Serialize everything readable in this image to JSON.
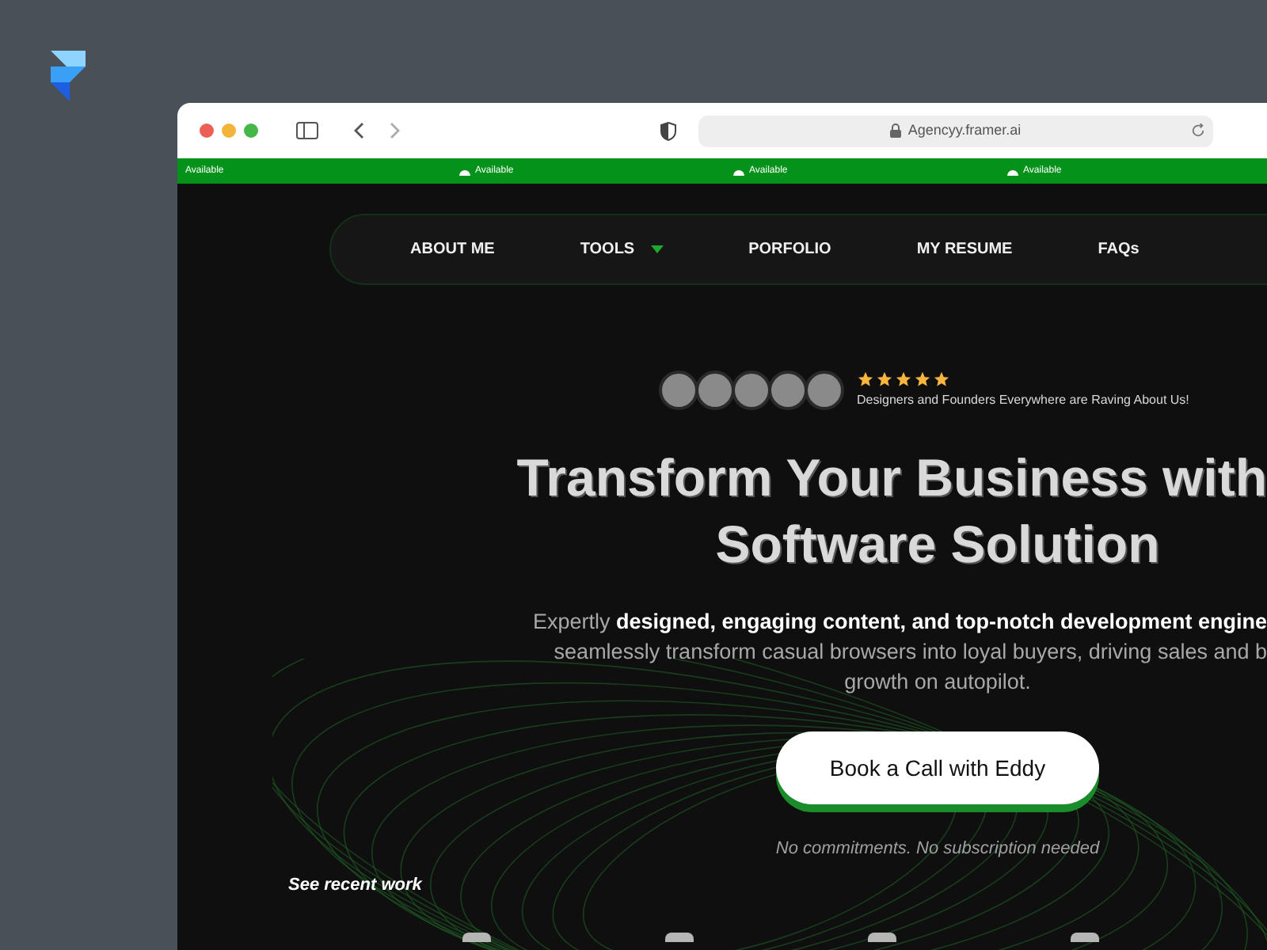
{
  "browser": {
    "url": "Agencyy.framer.ai"
  },
  "ticker": [
    {
      "label": "Available",
      "icon": false
    },
    {
      "label": "Available",
      "icon": true
    },
    {
      "label": "Available",
      "icon": true
    },
    {
      "label": "Available",
      "icon": true
    }
  ],
  "nav": [
    {
      "label": "ABOUT ME",
      "dropdown": false
    },
    {
      "label": "TOOLS",
      "dropdown": true
    },
    {
      "label": "PORFOLIO",
      "dropdown": false
    },
    {
      "label": "MY RESUME",
      "dropdown": false
    },
    {
      "label": "FAQs",
      "dropdown": false
    }
  ],
  "rating": {
    "stars": 5,
    "text": "Designers and Founders Everywhere are Raving About Us!"
  },
  "headline": [
    "Transform Your Business with",
    "Software Solution"
  ],
  "paragraph": [
    "Expertly **designed, engaging content, and top-notch development engine**",
    "seamlessly transform casual browsers into loyal buyers, driving sales and b",
    "growth on autopilot."
  ],
  "cta": {
    "label": "Book a Call with Eddy",
    "note": "No commitments. No subscription needed"
  },
  "recent_work": {
    "label": "See recent work"
  }
}
